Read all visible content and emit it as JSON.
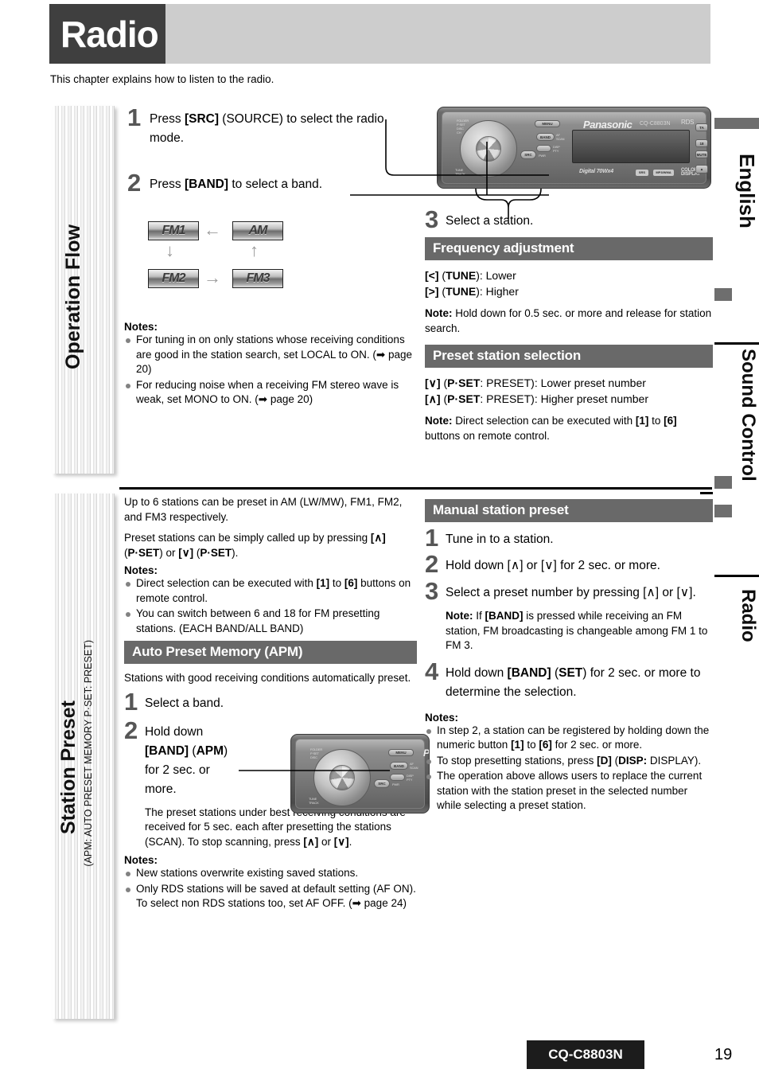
{
  "header": {
    "chapter_title": "Radio",
    "intro": "This chapter explains how to listen to the radio."
  },
  "left_tabs": [
    {
      "label": "Operation Flow"
    },
    {
      "label": "Station Preset",
      "sublabel": "(APM: AUTO PRESET MEMORY P·SET: PRESET)"
    }
  ],
  "right_tabs": [
    {
      "label": "English"
    },
    {
      "label": "Sound Control"
    },
    {
      "label": "Radio"
    }
  ],
  "operation_flow": {
    "step1": {
      "num": "1",
      "text_html": "Press <b>[SRC]</b> (SOURCE) to select the radio mode."
    },
    "step2": {
      "num": "2",
      "text_html": "Press <b>[BAND]</b> to select a band."
    },
    "band_diagram": {
      "chips": [
        "FM1",
        "AM",
        "FM2",
        "FM3"
      ],
      "arrows": [
        "←",
        "↓",
        "↑",
        "→"
      ]
    },
    "notes_head": "Notes:",
    "notes": [
      "For tuning in on only stations whose receiving conditions are good in the station search, set LOCAL to ON. (➡ page 20)",
      "For reducing noise when a receiving FM stereo wave is weak, set MONO to ON. (➡ page 20)"
    ]
  },
  "select_station": {
    "step3": {
      "num": "3",
      "text": "Select a station."
    },
    "frequency_adjustment": {
      "title": "Frequency adjustment",
      "lines_html": [
        "<b>[&lt;]</b> (<b>TUNE</b>): Lower",
        "<b>[&gt;]</b> (<b>TUNE</b>): Higher"
      ],
      "note_html": "<b>Note:</b> Hold down for 0.5 sec. or more and release for station search."
    },
    "preset_station_selection": {
      "title": "Preset station selection",
      "lines_html": [
        "<b>[∨]</b> (<b>P·SET</b>: PRESET): Lower preset number",
        "<b>[∧]</b> (<b>P·SET</b>: PRESET): Higher preset number"
      ],
      "note_html": "<b>Note:</b> Direct selection can be executed with <b>[1]</b> to <b>[6]</b> buttons on remote control."
    }
  },
  "station_preset": {
    "intro1": "Up to 6 stations can be preset in AM (LW/MW), FM1, FM2, and FM3 respectively.",
    "intro2_html": "Preset stations can be simply called up by pressing <b>[∧]</b> (<b>P·SET</b>) or <b>[∨]</b> (<b>P·SET</b>).",
    "notes_head": "Notes:",
    "notes_html": [
      "Direct selection can be executed with <b>[1]</b> to <b>[6]</b> buttons on remote control.",
      "You can switch between 6 and 18 for FM presetting stations. (EACH BAND/ALL BAND)"
    ],
    "apm": {
      "title": "Auto Preset Memory (APM)",
      "desc": "Stations with good receiving conditions automatically preset.",
      "step1": {
        "num": "1",
        "text": "Select a band."
      },
      "step2": {
        "num": "2",
        "text_html": "Hold down <b>[BAND]</b> (<b>APM</b>) for 2 sec. or more."
      },
      "detail_html": "The preset stations under best receiving conditions are received for 5 sec. each after presetting the stations (SCAN). To stop scanning, press <b>[∧]</b> or <b>[∨]</b>.",
      "notes_head": "Notes:",
      "notes": [
        "New stations overwrite existing saved stations.",
        "Only RDS stations will be saved at default setting (AF ON). To select non RDS stations too, set AF OFF. (➡ page 24)"
      ]
    }
  },
  "manual_station_preset": {
    "title": "Manual station preset",
    "step1": {
      "num": "1",
      "text": "Tune in to a station."
    },
    "step2": {
      "num": "2",
      "text_html": "Hold down [∧] or [∨] for 2 sec. or more."
    },
    "step3": {
      "num": "3",
      "text_html": "Select a preset number by pressing [∧] or [∨]."
    },
    "note3_html": "<b>Note:</b> If <b>[BAND]</b> is pressed while receiving an FM station, FM broadcasting is changeable among FM 1 to FM 3.",
    "step4": {
      "num": "4",
      "text_html": "Hold down <b>[BAND]</b> (<b>SET</b>) for 2 sec. or more to determine the selection."
    },
    "notes_head": "Notes:",
    "notes_html": [
      "In step 2, a station can be registered by holding down the numeric button <b>[1]</b> to <b>[6]</b> for 2 sec. or more.",
      "To stop presetting stations, press <b>[D]</b> (<b>DISP:</b> DISPLAY).",
      "The operation above allows users to replace the current station with the station preset in the selected number while selecting a preset station."
    ]
  },
  "device_image": {
    "brand": "Panasonic",
    "model": "CQ-C8803N",
    "labels": [
      "MENU",
      "BAND",
      "SRC",
      "PWR",
      "TUNE TRACK",
      "AF/SCAN",
      "DISP/PTY",
      "Digital 70Wx4",
      "COLOR DISPLAY"
    ],
    "side_buttons": [
      "TA",
      "18",
      "SCAN/MUTE"
    ]
  },
  "footer": {
    "model": "CQ-C8803N",
    "page": "19"
  },
  "colors": {
    "header_dark": "#3f3f3f",
    "header_band": "#cdcdcd",
    "section_bar": "#696969",
    "step_number": "#565656",
    "bullet": "#828282",
    "footer_box": "#1c1c1c"
  }
}
